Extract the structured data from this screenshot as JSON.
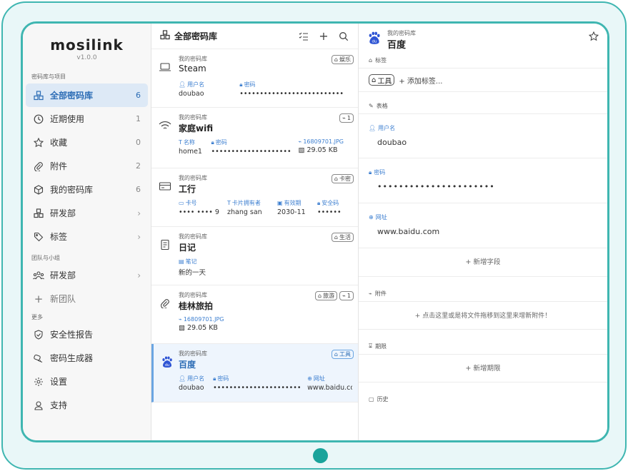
{
  "brand": {
    "logo": "mosilink",
    "version": "v1.0.0"
  },
  "sidebar": {
    "section1": "密码库与项目",
    "items": [
      {
        "label": "全部密码库",
        "count": "6",
        "icon": "vaults-icon",
        "active": true
      },
      {
        "label": "近期使用",
        "count": "1",
        "icon": "clock-icon"
      },
      {
        "label": "收藏",
        "count": "0",
        "icon": "star-icon"
      },
      {
        "label": "附件",
        "count": "2",
        "icon": "paperclip-icon"
      },
      {
        "label": "我的密码库",
        "count": "6",
        "icon": "cube-icon"
      },
      {
        "label": "研发部",
        "icon": "vaults-icon",
        "chevron": "›"
      },
      {
        "label": "标签",
        "icon": "tag-icon",
        "chevron": "›"
      }
    ],
    "section2": "团队与小组",
    "team_items": [
      {
        "label": "研发部",
        "icon": "team-icon",
        "chevron": "›"
      },
      {
        "label": "新团队",
        "icon": "plus-icon"
      }
    ],
    "section3": "更多",
    "more_items": [
      {
        "label": "安全性报告",
        "icon": "shield-icon"
      },
      {
        "label": "密码生成器",
        "icon": "key-icon"
      },
      {
        "label": "设置",
        "icon": "gear-icon"
      },
      {
        "label": "支持",
        "icon": "support-icon"
      }
    ]
  },
  "list": {
    "title": "全部密码库",
    "items": [
      {
        "vault": "我的密码库",
        "name": "Steam",
        "icon": "laptop-icon",
        "tags": [
          {
            "label": "娱乐",
            "type": "tag"
          }
        ],
        "fields": [
          {
            "label": "用户名",
            "value": "doubao"
          },
          {
            "label": "密码",
            "value": "••••••••••••••••••••••••••"
          }
        ]
      },
      {
        "vault": "我的密码库",
        "name": "家庭wifi",
        "icon": "wifi-icon",
        "tags": [
          {
            "label": "1",
            "type": "attach"
          }
        ],
        "fields": [
          {
            "label": "名称",
            "value": "home1"
          },
          {
            "label": "密码",
            "value": "••••••••••••••••••••"
          }
        ],
        "attachment": {
          "label": "16809701.JPG",
          "size": "29.05 KB"
        }
      },
      {
        "vault": "我的密码库",
        "name": "工行",
        "icon": "card-icon",
        "tags": [
          {
            "label": "卡密",
            "type": "tag"
          }
        ],
        "fields": [
          {
            "label": "卡号",
            "value": "•••• •••• 9"
          },
          {
            "label": "卡片拥有者",
            "value": "zhang san"
          },
          {
            "label": "有效期",
            "value": "2030-11"
          },
          {
            "label": "安全码",
            "value": "••••••"
          }
        ]
      },
      {
        "vault": "我的密码库",
        "name": "日记",
        "icon": "note-icon",
        "tags": [
          {
            "label": "生活",
            "type": "tag"
          }
        ],
        "fields": [
          {
            "label": "笔记",
            "value": "新的一天"
          }
        ]
      },
      {
        "vault": "我的密码库",
        "name": "桂林旅拍",
        "icon": "paperclip-icon",
        "tags": [
          {
            "label": "旅游",
            "type": "tag"
          },
          {
            "label": "1",
            "type": "attach"
          }
        ],
        "attachment": {
          "label": "16809701.JPG",
          "size": "29.05 KB"
        }
      },
      {
        "vault": "我的密码库",
        "name": "百度",
        "icon": "baidu-icon",
        "tags": [
          {
            "label": "工具",
            "type": "tag"
          }
        ],
        "fields": [
          {
            "label": "用户名",
            "value": "doubao"
          },
          {
            "label": "密码",
            "value": "••••••••••••••••••••••"
          },
          {
            "label": "网址",
            "value": "www.baidu.com"
          }
        ]
      }
    ]
  },
  "detail": {
    "vault": "我的密码库",
    "title": "百度",
    "tags_section": "标签",
    "tag": "工具",
    "add_tag": "添加标签...",
    "form_section": "表格",
    "username_label": "用户名",
    "username": "doubao",
    "password_label": "密码",
    "password": "••••••••••••••••••••••",
    "url_label": "网址",
    "url": "www.baidu.com",
    "add_field": "+ 新增字段",
    "attach_section": "附件",
    "attach_hint": "+ 点击这里或是将文件拖移到这里来增新附件！",
    "expiry_section": "期限",
    "add_expiry": "+ 新增期限",
    "history_section": "历史"
  },
  "colors": {
    "accent": "#2b6cb5",
    "frame": "#3fb6b1",
    "active_bg": "#dde9f6"
  }
}
